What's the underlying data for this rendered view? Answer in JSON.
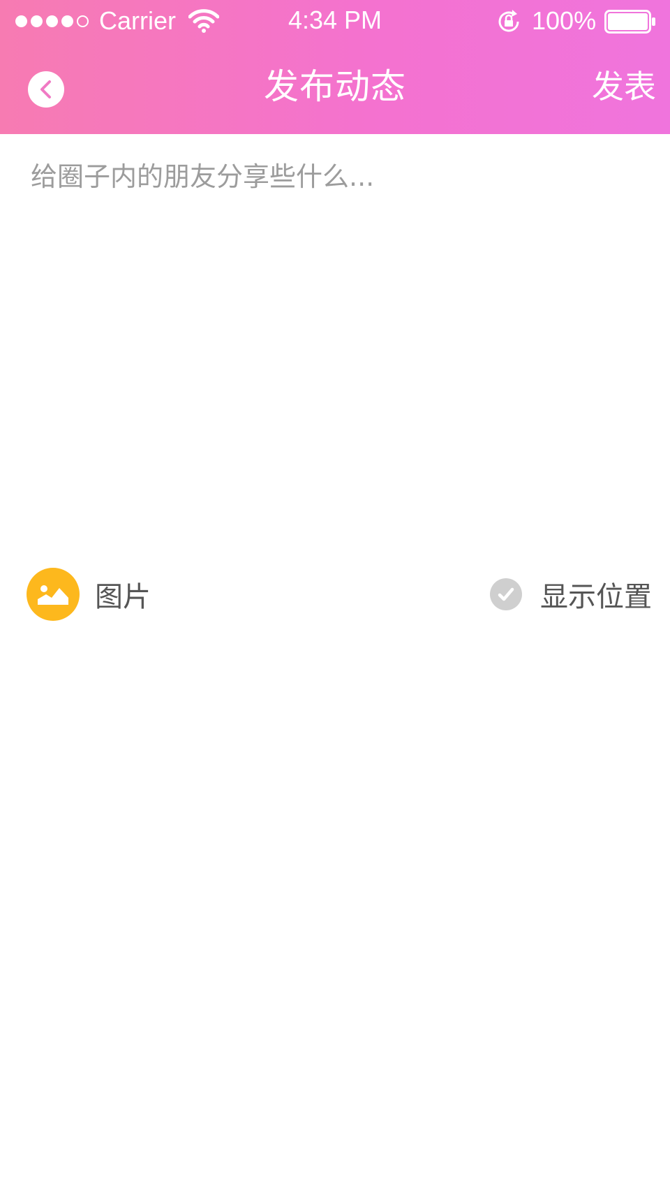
{
  "status_bar": {
    "carrier": "Carrier",
    "time": "4:34 PM",
    "battery": "100%",
    "signal_icon": "signal-dots-icon",
    "wifi_icon": "wifi-icon",
    "rotation_icon": "rotation-lock-icon",
    "battery_icon": "battery-icon"
  },
  "nav": {
    "title": "发布动态",
    "publish_label": "发表",
    "back_icon": "back-arrow-icon"
  },
  "compose": {
    "value": "",
    "placeholder": "给圈子内的朋友分享些什么..."
  },
  "toolbar": {
    "photo_label": "图片",
    "photo_icon": "photo-icon",
    "location_label": "显示位置",
    "location_icon": "check-icon"
  },
  "colors": {
    "header_start": "#f77bb2",
    "header_end": "#f074dd",
    "photo_icon_bg": "#fdb81d",
    "check_bg": "#cfcfcf",
    "placeholder": "#9c9c9c"
  }
}
